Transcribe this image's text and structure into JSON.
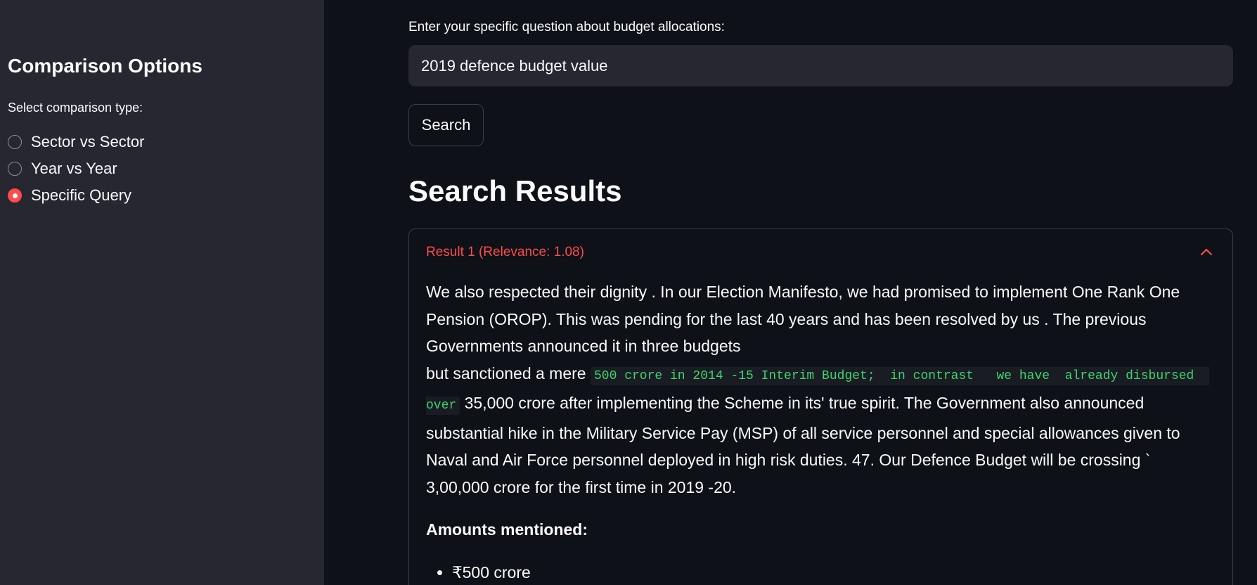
{
  "sidebar": {
    "title": "Comparison Options",
    "select_label": "Select comparison type:",
    "options": [
      {
        "label": "Sector vs Sector",
        "selected": false
      },
      {
        "label": "Year vs Year",
        "selected": false
      },
      {
        "label": "Specific Query",
        "selected": true
      }
    ]
  },
  "main": {
    "question_label": "Enter your specific question about budget allocations:",
    "question_value": "2019 defence budget value",
    "search_label": "Search",
    "results_title": "Search Results",
    "result": {
      "header": "Result 1 (Relevance: 1.08)",
      "para1": "We also respected their dignity . In our Election Manifesto, we had promised to implement One Rank One Pension (OROP). This was pending for the last 40 years and has been resolved by us . The previous Governments announced it in three budgets",
      "para2_prefix": "but sanctioned a mere ",
      "para2_code": "500 crore in 2014 -15 Interim Budget;  in contrast   we have  already disbursed  over",
      "para2_suffix": " 35,000 crore after implementing the Scheme in its' true spirit. The Government also announced substantial hike in the Military Service Pay (MSP) of all service personnel and special allowances given to Naval and Air Force personnel deployed in high risk duties. 47. Our Defence Budget will be crossing ` 3,00,000 crore for the first time in 2019 -20.",
      "amounts_title": "Amounts mentioned:",
      "amounts": [
        "₹500 crore"
      ]
    }
  },
  "colors": {
    "accent": "#ff4b4b",
    "code_text": "#3dd56d",
    "sidebar_bg": "#262730",
    "main_bg": "#0e1117"
  }
}
